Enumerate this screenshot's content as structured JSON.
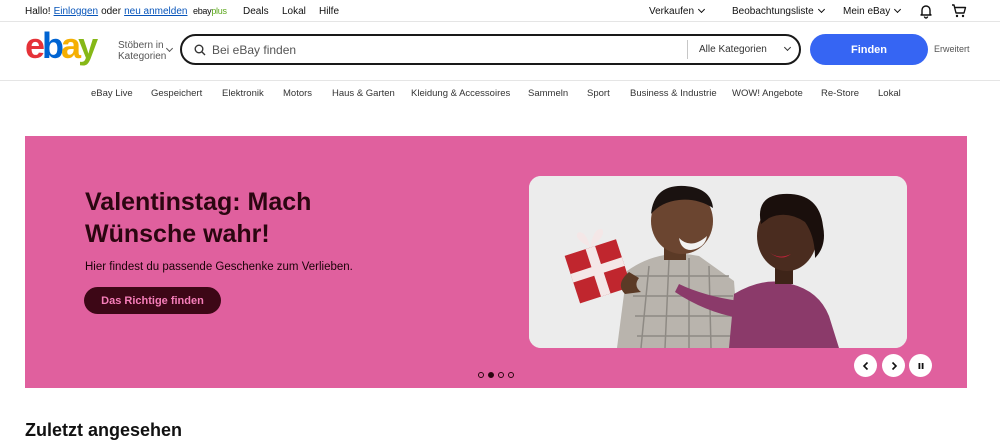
{
  "topbar": {
    "greeting": "Hallo!",
    "login_link": "Einloggen",
    "or_text": "oder",
    "register_link": "neu anmelden",
    "ebayplus_left": "ebay",
    "ebayplus_right": "plus",
    "deals": "Deals",
    "local": "Lokal",
    "help": "Hilfe",
    "sell": "Verkaufen",
    "watchlist": "Beobachtungsliste",
    "my_ebay": "Mein eBay",
    "notifications_icon": "bell-icon",
    "cart_icon": "cart-icon"
  },
  "header": {
    "logo_text": "ebay",
    "logo_colors": [
      "#e53238",
      "#0064d2",
      "#f5af02",
      "#86b817"
    ],
    "browse_line1": "Stöbern in",
    "browse_line2": "Kategorien",
    "search_placeholder": "Bei eBay finden",
    "category_select": "Alle Kategorien",
    "search_button": "Finden",
    "advanced": "Erweitert",
    "accent_color": "#3665f3"
  },
  "nav": {
    "items": [
      "eBay Live",
      "Gespeichert",
      "Elektronik",
      "Motors",
      "Haus & Garten",
      "Kleidung & Accessoires",
      "Sammeln",
      "Sport",
      "Business & Industrie",
      "WOW! Angebote",
      "Re-Store",
      "Lokal"
    ]
  },
  "hero": {
    "title": "Valentinstag: Mach Wünsche wahr!",
    "subtitle": "Hier findest du passende Geschenke zum Verlieben.",
    "cta": "Das Richtige finden",
    "background_color": "#e0609e",
    "slide_count": 4,
    "active_slide": 2
  },
  "section": {
    "title": "Zuletzt angesehen"
  }
}
